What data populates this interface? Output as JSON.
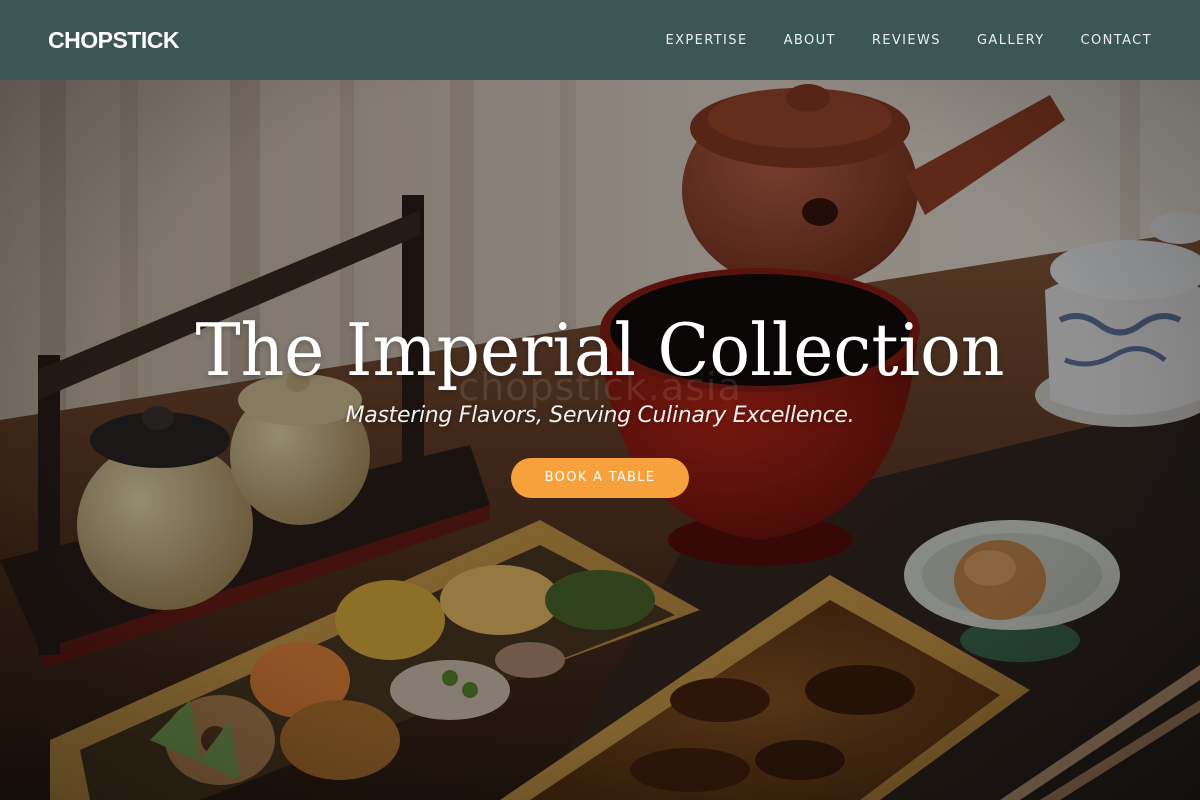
{
  "brand": {
    "name": "CHOPSTICK"
  },
  "nav": {
    "items": [
      {
        "label": "EXPERTISE"
      },
      {
        "label": "ABOUT"
      },
      {
        "label": "REVIEWS"
      },
      {
        "label": "GALLERY"
      },
      {
        "label": "CONTACT"
      }
    ]
  },
  "hero": {
    "title": "The Imperial Collection",
    "subtitle": "Mastering Flavors, Serving Culinary Excellence.",
    "cta_label": "BOOK A TABLE",
    "watermark": "chopstick.asia"
  },
  "colors": {
    "navbar": "#3b5654",
    "accent": "#f7a13c",
    "text_light": "#ffffff"
  },
  "icons": {
    "background_image": "bento-teapot-photo"
  }
}
